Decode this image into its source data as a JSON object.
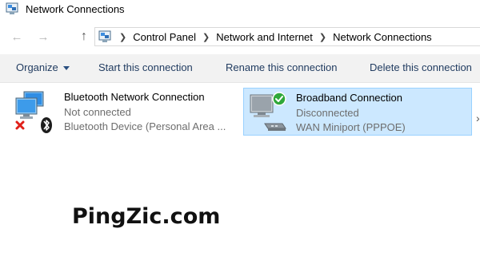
{
  "window": {
    "title": "Network Connections"
  },
  "nav": {
    "breadcrumb": [
      "Control Panel",
      "Network and Internet",
      "Network Connections"
    ]
  },
  "toolbar": {
    "organize": "Organize",
    "start": "Start this connection",
    "rename": "Rename this connection",
    "delete": "Delete this connection"
  },
  "connections": [
    {
      "name": "Bluetooth Network Connection",
      "status": "Not connected",
      "device": "Bluetooth Device (Personal Area ...",
      "icon": "bluetooth-network-icon",
      "selected": false
    },
    {
      "name": "Broadband Connection",
      "status": "Disconnected",
      "device": "WAN Miniport (PPPOE)",
      "icon": "broadband-network-icon",
      "selected": true
    }
  ],
  "watermark": "PingZic.com",
  "colors": {
    "selection_bg": "#cce8ff",
    "selection_border": "#99d1ff",
    "command_text": "#1f3a5f",
    "secondary_text": "#6d6d6d",
    "toolbar_bg": "#f2f2f2"
  }
}
